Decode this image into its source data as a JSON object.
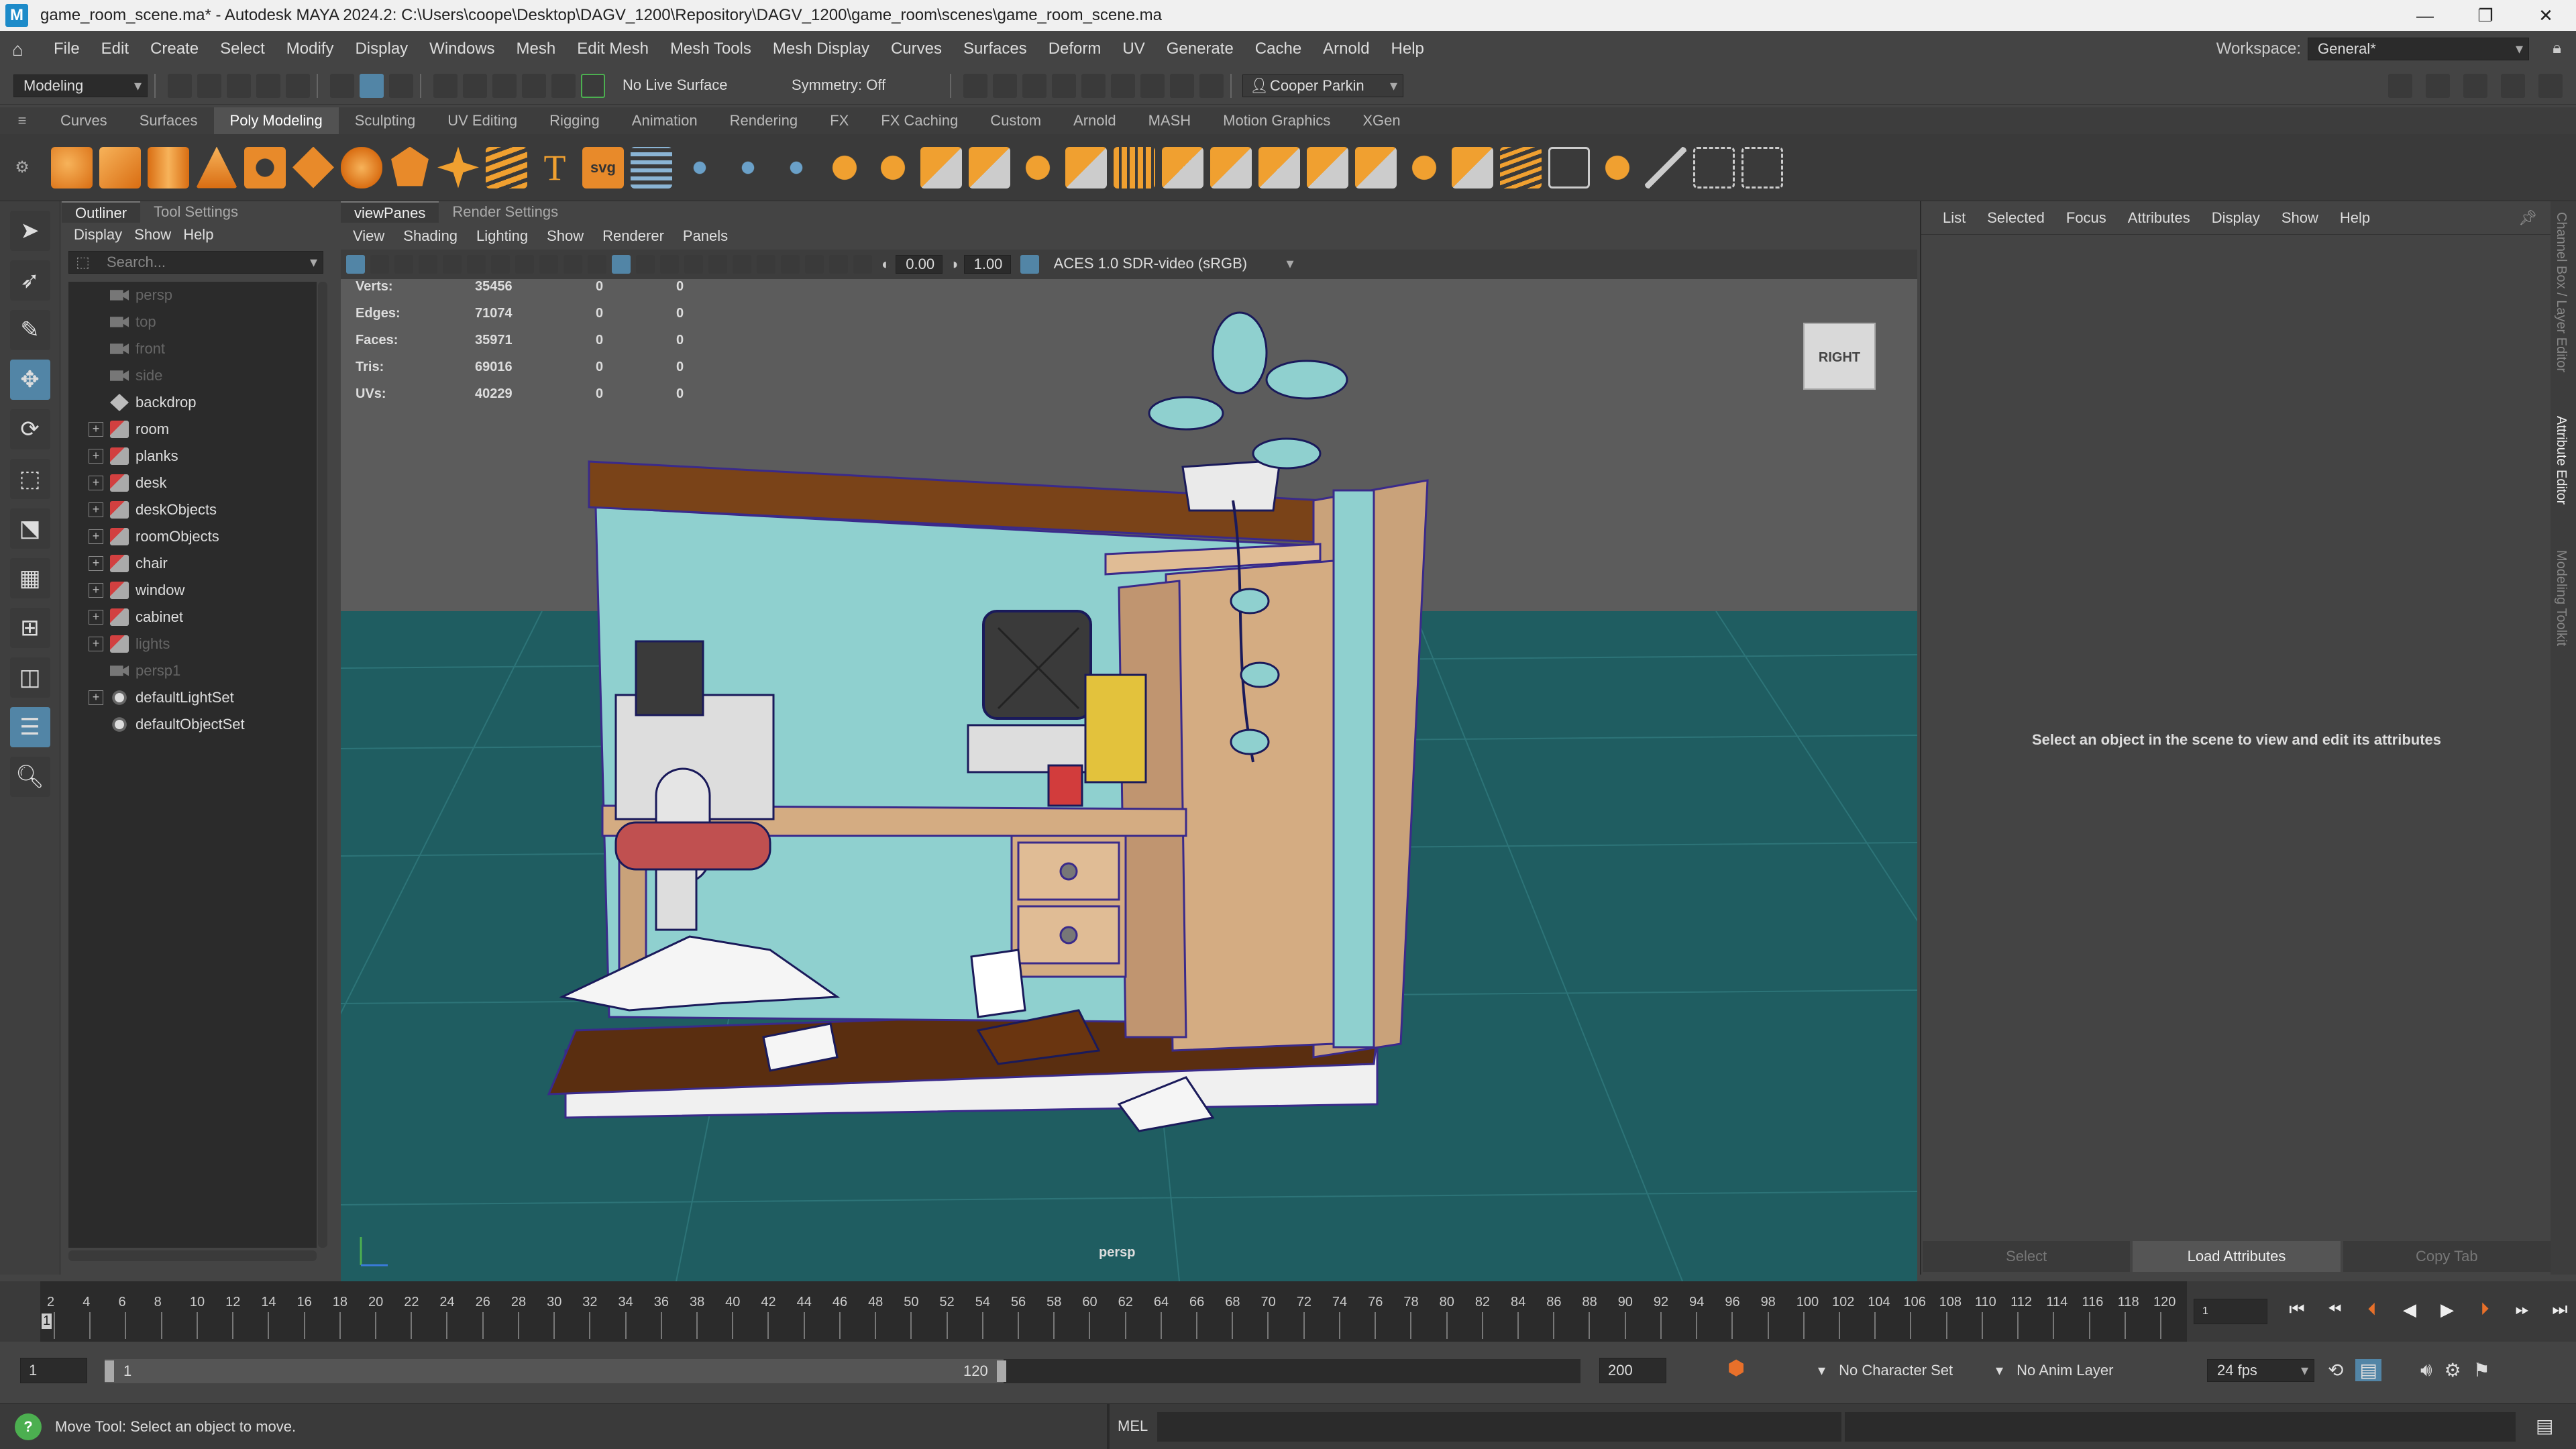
{
  "window": {
    "title": "game_room_scene.ma* - Autodesk MAYA 2024.2: C:\\Users\\coope\\Desktop\\DAGV_1200\\Repository\\DAGV_1200\\game_room\\scenes\\game_room_scene.ma",
    "app_icon": "M",
    "minimize": "—",
    "maximize": "❐",
    "close": "✕"
  },
  "menubar": {
    "items": [
      "File",
      "Edit",
      "Create",
      "Select",
      "Modify",
      "Display",
      "Windows",
      "Mesh",
      "Edit Mesh",
      "Mesh Tools",
      "Mesh Display",
      "Curves",
      "Surfaces",
      "Deform",
      "UV",
      "Generate",
      "Cache",
      "Arnold",
      "Help"
    ],
    "workspace_label": "Workspace:",
    "workspace_value": "General*"
  },
  "statusline": {
    "mode": "Modeling",
    "live_surface": "No Live Surface",
    "symmetry": "Symmetry: Off",
    "user": "Cooper Parkin"
  },
  "shelf": {
    "tabs": [
      "Curves",
      "Surfaces",
      "Poly Modeling",
      "Sculpting",
      "UV Editing",
      "Rigging",
      "Animation",
      "Rendering",
      "FX",
      "FX Caching",
      "Custom",
      "Arnold",
      "MASH",
      "Motion Graphics",
      "XGen"
    ],
    "active_tab": "Poly Modeling",
    "svg_label": "svg",
    "text_label": "T"
  },
  "outliner": {
    "tabs": [
      "Outliner",
      "Tool Settings"
    ],
    "menu": [
      "Display",
      "Show",
      "Help"
    ],
    "search_placeholder": "Search...",
    "items": [
      {
        "label": "persp",
        "type": "camera",
        "expandable": false,
        "dim": true
      },
      {
        "label": "top",
        "type": "camera",
        "expandable": false,
        "dim": true
      },
      {
        "label": "front",
        "type": "camera",
        "expandable": false,
        "dim": true
      },
      {
        "label": "side",
        "type": "camera",
        "expandable": false,
        "dim": true
      },
      {
        "label": "backdrop",
        "type": "mesh",
        "expandable": false,
        "dim": false
      },
      {
        "label": "room",
        "type": "group",
        "expandable": true,
        "dim": false
      },
      {
        "label": "planks",
        "type": "group",
        "expandable": true,
        "dim": false
      },
      {
        "label": "desk",
        "type": "group",
        "expandable": true,
        "dim": false
      },
      {
        "label": "deskObjects",
        "type": "group",
        "expandable": true,
        "dim": false
      },
      {
        "label": "roomObjects",
        "type": "group",
        "expandable": true,
        "dim": false
      },
      {
        "label": "chair",
        "type": "group",
        "expandable": true,
        "dim": false
      },
      {
        "label": "window",
        "type": "group",
        "expandable": true,
        "dim": false
      },
      {
        "label": "cabinet",
        "type": "group",
        "expandable": true,
        "dim": false
      },
      {
        "label": "lights",
        "type": "group",
        "expandable": true,
        "dim": true
      },
      {
        "label": "persp1",
        "type": "camera",
        "expandable": false,
        "dim": true
      },
      {
        "label": "defaultLightSet",
        "type": "set",
        "expandable": true,
        "dim": false
      },
      {
        "label": "defaultObjectSet",
        "type": "set",
        "expandable": false,
        "dim": false
      }
    ]
  },
  "viewpanel": {
    "tabs": [
      "viewPanes",
      "Render Settings"
    ],
    "menu": [
      "View",
      "Shading",
      "Lighting",
      "Show",
      "Renderer",
      "Panels"
    ],
    "exposure": "0.00",
    "gamma": "1.00",
    "color_space": "ACES 1.0 SDR-video (sRGB)",
    "camera_label": "persp",
    "viewcube_label": "RIGHT",
    "hud": [
      {
        "label": "Verts:",
        "value": "35456",
        "sel": "0",
        "comp": "0"
      },
      {
        "label": "Edges:",
        "value": "71074",
        "sel": "0",
        "comp": "0"
      },
      {
        "label": "Faces:",
        "value": "35971",
        "sel": "0",
        "comp": "0"
      },
      {
        "label": "Tris:",
        "value": "69016",
        "sel": "0",
        "comp": "0"
      },
      {
        "label": "UVs:",
        "value": "40229",
        "sel": "0",
        "comp": "0"
      }
    ]
  },
  "attribute_editor": {
    "menu": [
      "List",
      "Selected",
      "Focus",
      "Attributes",
      "Display",
      "Show",
      "Help"
    ],
    "message": "Select an object in the scene to view and edit its attributes",
    "buttons": [
      "Select",
      "Load Attributes",
      "Copy Tab"
    ],
    "side_tabs": [
      "Channel Box / Layer Editor",
      "Attribute Editor",
      "Modeling Toolkit"
    ]
  },
  "timeslider": {
    "ticks": [
      "2",
      "4",
      "6",
      "8",
      "10",
      "12",
      "14",
      "16",
      "18",
      "20",
      "22",
      "24",
      "26",
      "28",
      "30",
      "32",
      "34",
      "36",
      "38",
      "40",
      "42",
      "44",
      "46",
      "48",
      "50",
      "52",
      "54",
      "56",
      "58",
      "60",
      "62",
      "64",
      "66",
      "68",
      "70",
      "72",
      "74",
      "76",
      "78",
      "80",
      "82",
      "84",
      "86",
      "88",
      "90",
      "92",
      "94",
      "96",
      "98",
      "100",
      "102",
      "104",
      "106",
      "108",
      "110",
      "112",
      "114",
      "116",
      "118",
      "120"
    ],
    "current_frame": "1",
    "playhead_frame": "1"
  },
  "rangeslider": {
    "start": "1",
    "range_start": "1",
    "range_end": "120",
    "end": "200",
    "character_set": "No Character Set",
    "anim_layer": "No Anim Layer",
    "fps": "24 fps"
  },
  "commandline": {
    "help": "Move Tool: Select an object to move.",
    "lang": "MEL"
  },
  "colors": {
    "accent": "#5285a6",
    "floor": "#1e5c60",
    "wall": "#8fd0cf",
    "wood": "#c9a27a",
    "plank": "#5a2e10"
  }
}
